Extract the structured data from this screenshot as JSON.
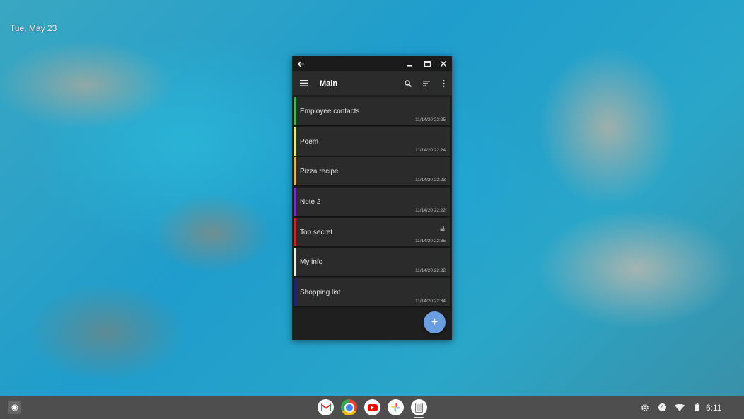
{
  "desktop": {
    "date": "Tue, May 23"
  },
  "window": {
    "titlebar": {
      "back_icon": "arrow-left-icon",
      "minimize_icon": "minimize-icon",
      "maximize_icon": "maximize-icon",
      "close_icon": "close-icon"
    },
    "appbar": {
      "title": "Main",
      "menu_icon": "hamburger-menu-icon",
      "search_icon": "search-icon",
      "sort_icon": "sort-icon",
      "more_icon": "more-vert-icon"
    },
    "notes": [
      {
        "title": "Employee contacts",
        "date": "11/14/20",
        "time": "22:25",
        "color": "#4caf50",
        "locked": false
      },
      {
        "title": "Poem",
        "date": "11/14/20",
        "time": "22:24",
        "color": "#e6e67a",
        "locked": false
      },
      {
        "title": "Pizza recipe",
        "date": "11/14/20",
        "time": "22:23",
        "color": "#e0b060",
        "locked": false
      },
      {
        "title": "Note 2",
        "date": "11/14/20",
        "time": "22:22",
        "color": "#7b2fbf",
        "locked": false
      },
      {
        "title": "Top secret",
        "date": "11/14/20",
        "time": "22:35",
        "color": "#c62828",
        "locked": true
      },
      {
        "title": "My info",
        "date": "11/14/20",
        "time": "22:32",
        "color": "#e8e8e8",
        "locked": false
      },
      {
        "title": "Shopping list",
        "date": "11/14/20",
        "time": "22:34",
        "color": "#1a237e",
        "locked": false
      }
    ],
    "fab_label": "+"
  },
  "shelf": {
    "apps": [
      "Gmail",
      "Chrome",
      "YouTube",
      "Photos",
      "Notes"
    ],
    "tray": {
      "notification_count": "4",
      "time": "6:11"
    }
  }
}
